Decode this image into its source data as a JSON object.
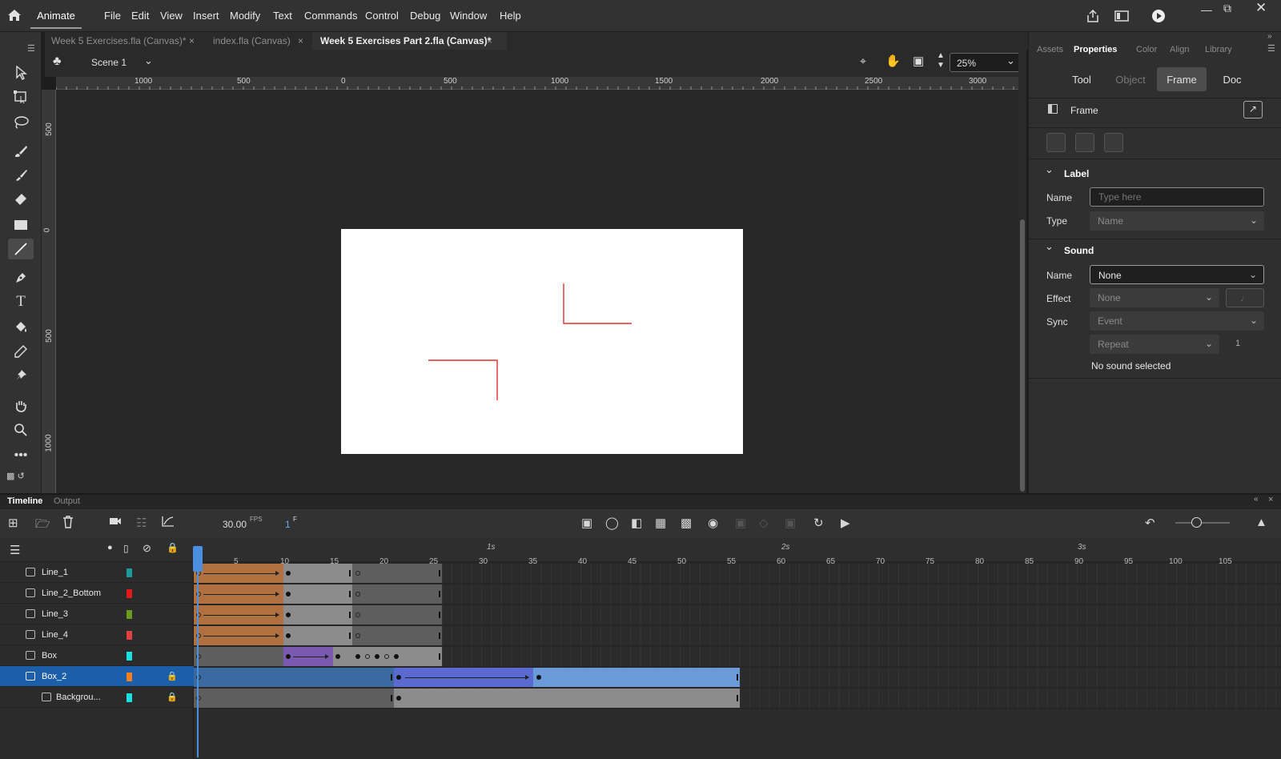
{
  "app": {
    "name": "Animate"
  },
  "menu": [
    "File",
    "Edit",
    "View",
    "Insert",
    "Modify",
    "Text",
    "Commands",
    "Control",
    "Debug",
    "Window",
    "Help"
  ],
  "tabs": [
    {
      "label": "Week 5 Exercises.fla (Canvas)*",
      "active": false
    },
    {
      "label": "index.fla (Canvas)",
      "active": false
    },
    {
      "label": "Week 5 Exercises Part 2.fla (Canvas)*",
      "active": true
    }
  ],
  "stagebar": {
    "scene": "Scene 1",
    "zoom": "25%"
  },
  "ruler_h": [
    "1000",
    "500",
    "0",
    "500",
    "1000",
    "1500",
    "2000",
    "2500",
    "3000"
  ],
  "ruler_v": [
    "500",
    "0",
    "500",
    "1000"
  ],
  "properties": {
    "panel_tabs": [
      "Assets",
      "Properties",
      "Color",
      "Align",
      "Library"
    ],
    "active_panel_tab": "Properties",
    "segments": [
      "Tool",
      "Object",
      "Frame",
      "Doc"
    ],
    "active_segment": "Frame",
    "header": "Frame",
    "label_section": {
      "title": "Label",
      "name_label": "Name",
      "name_placeholder": "Type here",
      "type_label": "Type",
      "type_value": "Name"
    },
    "sound_section": {
      "title": "Sound",
      "name_label": "Name",
      "name_value": "None",
      "effect_label": "Effect",
      "effect_value": "None",
      "sync_label": "Sync",
      "sync_value": "Event",
      "repeat_value": "Repeat",
      "repeat_count": "1",
      "status": "No sound selected"
    }
  },
  "timeline": {
    "tabs": [
      "Timeline",
      "Output"
    ],
    "active_tab": "Timeline",
    "fps": "30.00",
    "fps_unit": "FPS",
    "current_frame": "1",
    "frame_unit": "F",
    "frame_numbers": [
      "5",
      "10",
      "15",
      "20",
      "25",
      "30",
      "35",
      "40",
      "45",
      "50",
      "55",
      "60",
      "65",
      "70",
      "75",
      "80",
      "85",
      "90",
      "95",
      "100",
      "105"
    ],
    "time_labels": [
      "1s",
      "2s",
      "3s"
    ],
    "layers": [
      {
        "name": "Line_1",
        "color": "#1a9a9a",
        "locked": false,
        "selected": false
      },
      {
        "name": "Line_2_Bottom",
        "color": "#e01a1a",
        "locked": false,
        "selected": false
      },
      {
        "name": "Line_3",
        "color": "#6a9a1a",
        "locked": false,
        "selected": false
      },
      {
        "name": "Line_4",
        "color": "#e04040",
        "locked": false,
        "selected": false
      },
      {
        "name": "Box",
        "color": "#1ae0e0",
        "locked": false,
        "selected": false
      },
      {
        "name": "Box_2",
        "color": "#f08020",
        "locked": true,
        "selected": true
      },
      {
        "name": "Backgrou...",
        "color": "#1ae0e0",
        "locked": true,
        "selected": false
      }
    ]
  },
  "colors": {
    "accent": "#4a8fe0",
    "tween_orange": "#b07040",
    "tween_purple": "#7a5ab0",
    "tween_blue": "#5a6ad0",
    "selected_layer": "#1c5fa8",
    "stage_line": "#e03030"
  }
}
